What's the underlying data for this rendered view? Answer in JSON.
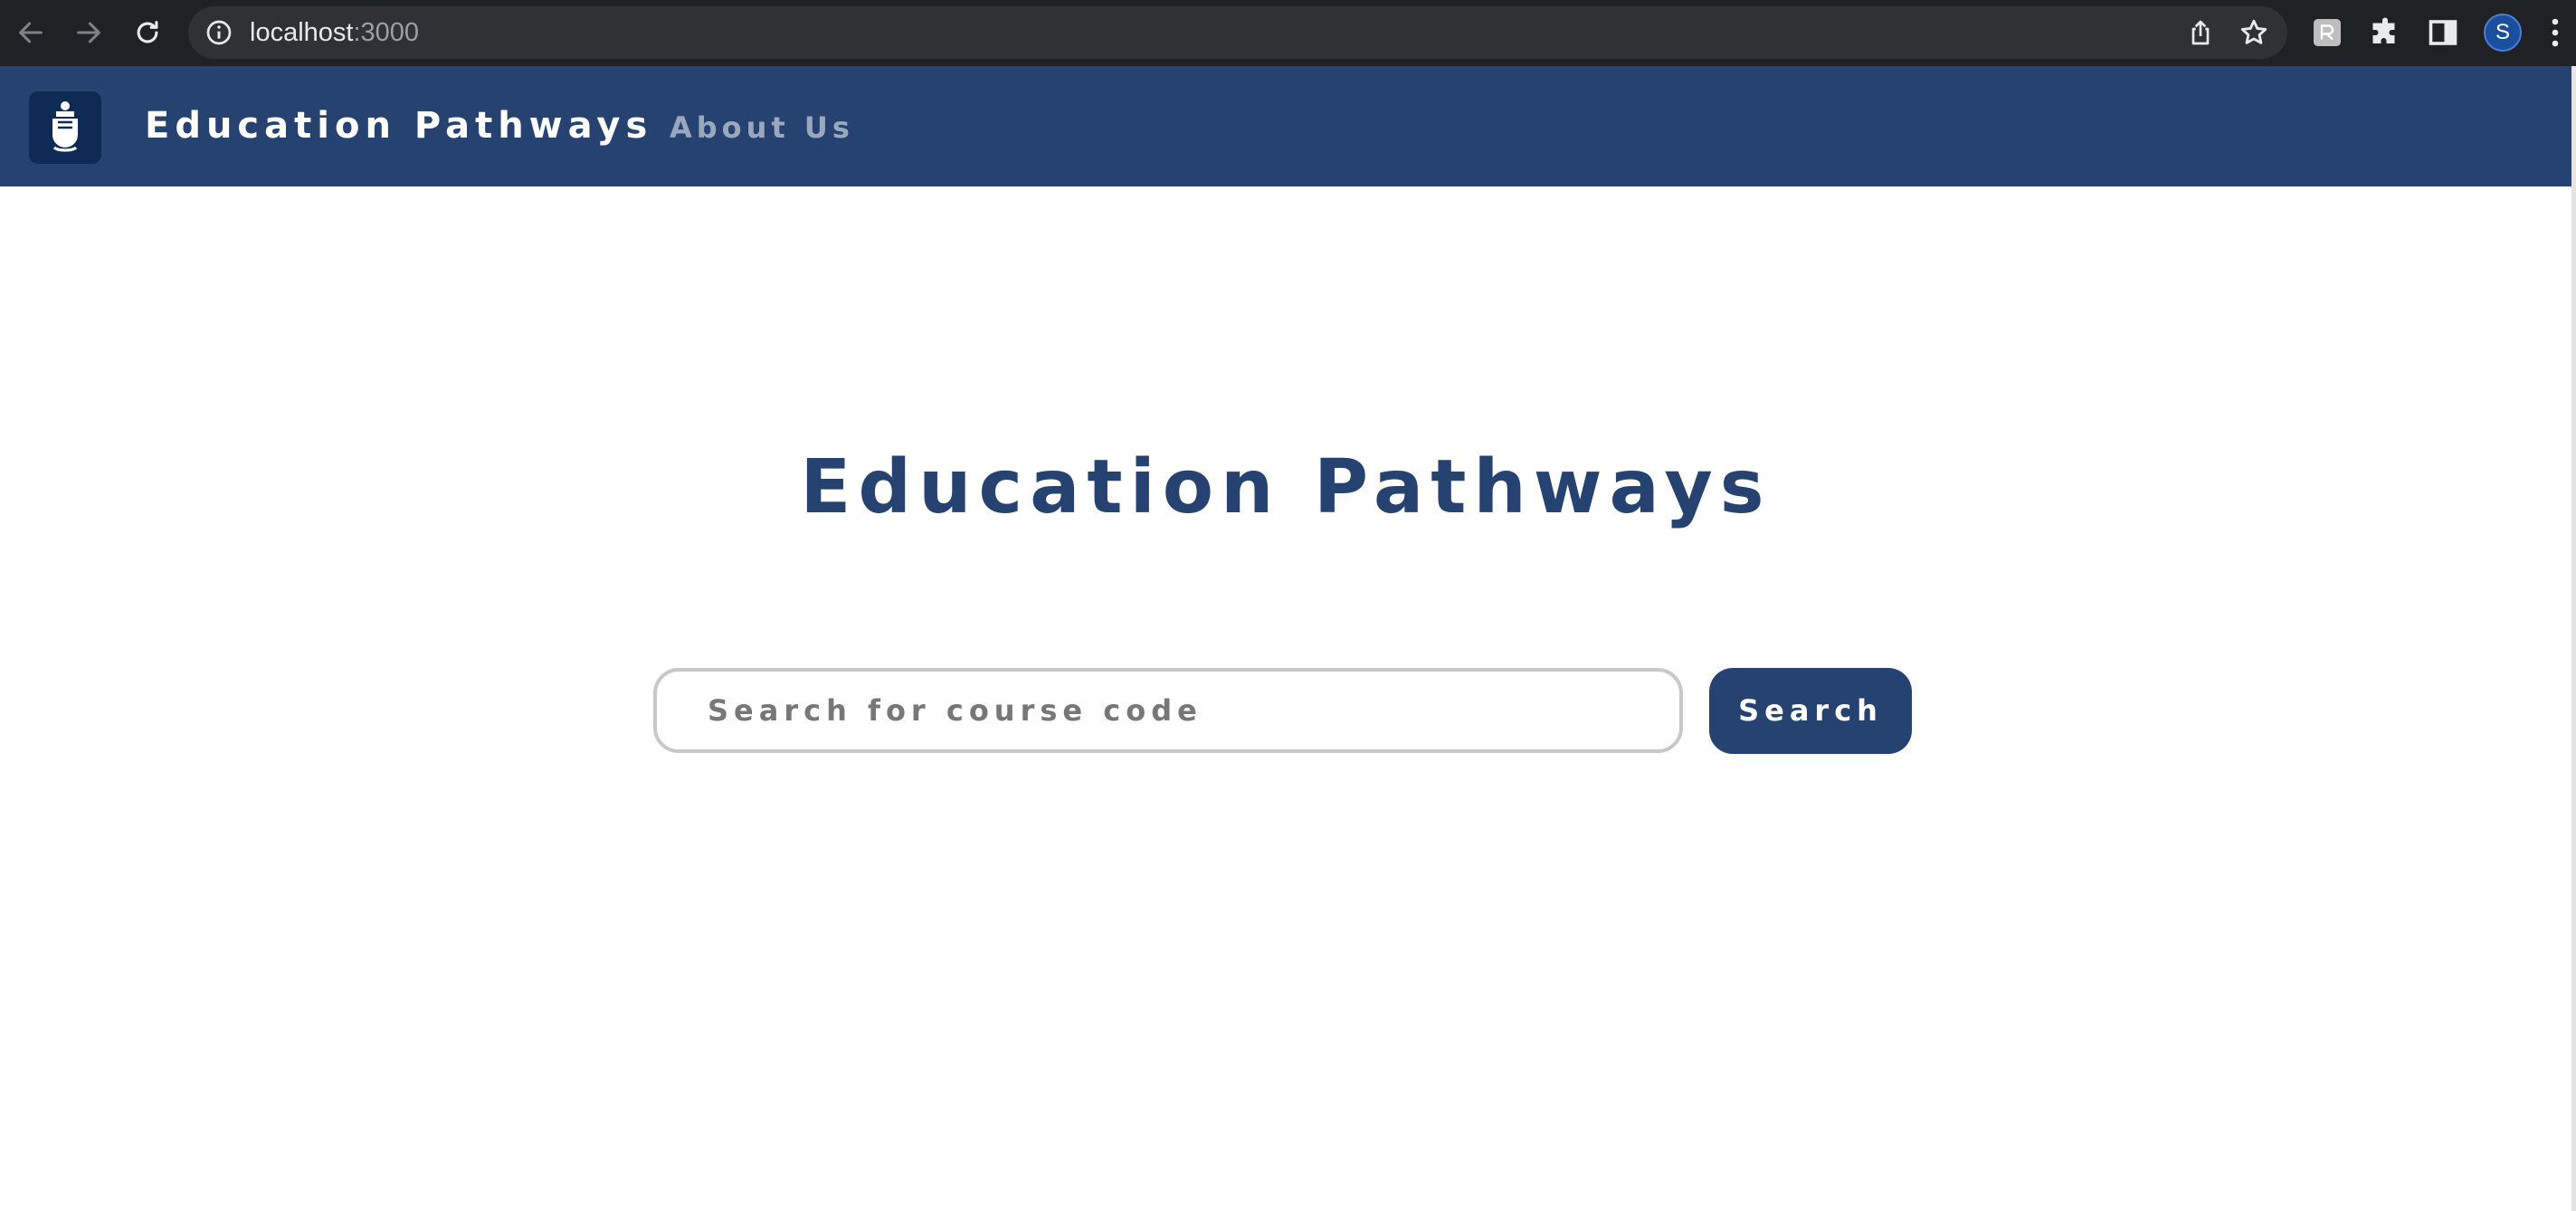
{
  "browser": {
    "url_host": "localhost",
    "url_port": ":3000",
    "profile_initial": "S",
    "icons": [
      "back-icon",
      "forward-icon",
      "reload-icon",
      "site-info-icon",
      "share-icon",
      "bookmark-star-icon",
      "extension-icon",
      "puzzle-icon",
      "side-panel-icon",
      "menu-kebab-icon"
    ]
  },
  "navbar": {
    "brand": "Education Pathways",
    "links": [
      {
        "label": "About Us"
      }
    ],
    "background": "#264270"
  },
  "main": {
    "title": "Education Pathways",
    "search": {
      "placeholder": "Search for course code",
      "value": "",
      "button_label": "Search"
    }
  },
  "colors": {
    "primary": "#264270",
    "nav_link": "#9aa7bd",
    "chrome": "#202124"
  }
}
